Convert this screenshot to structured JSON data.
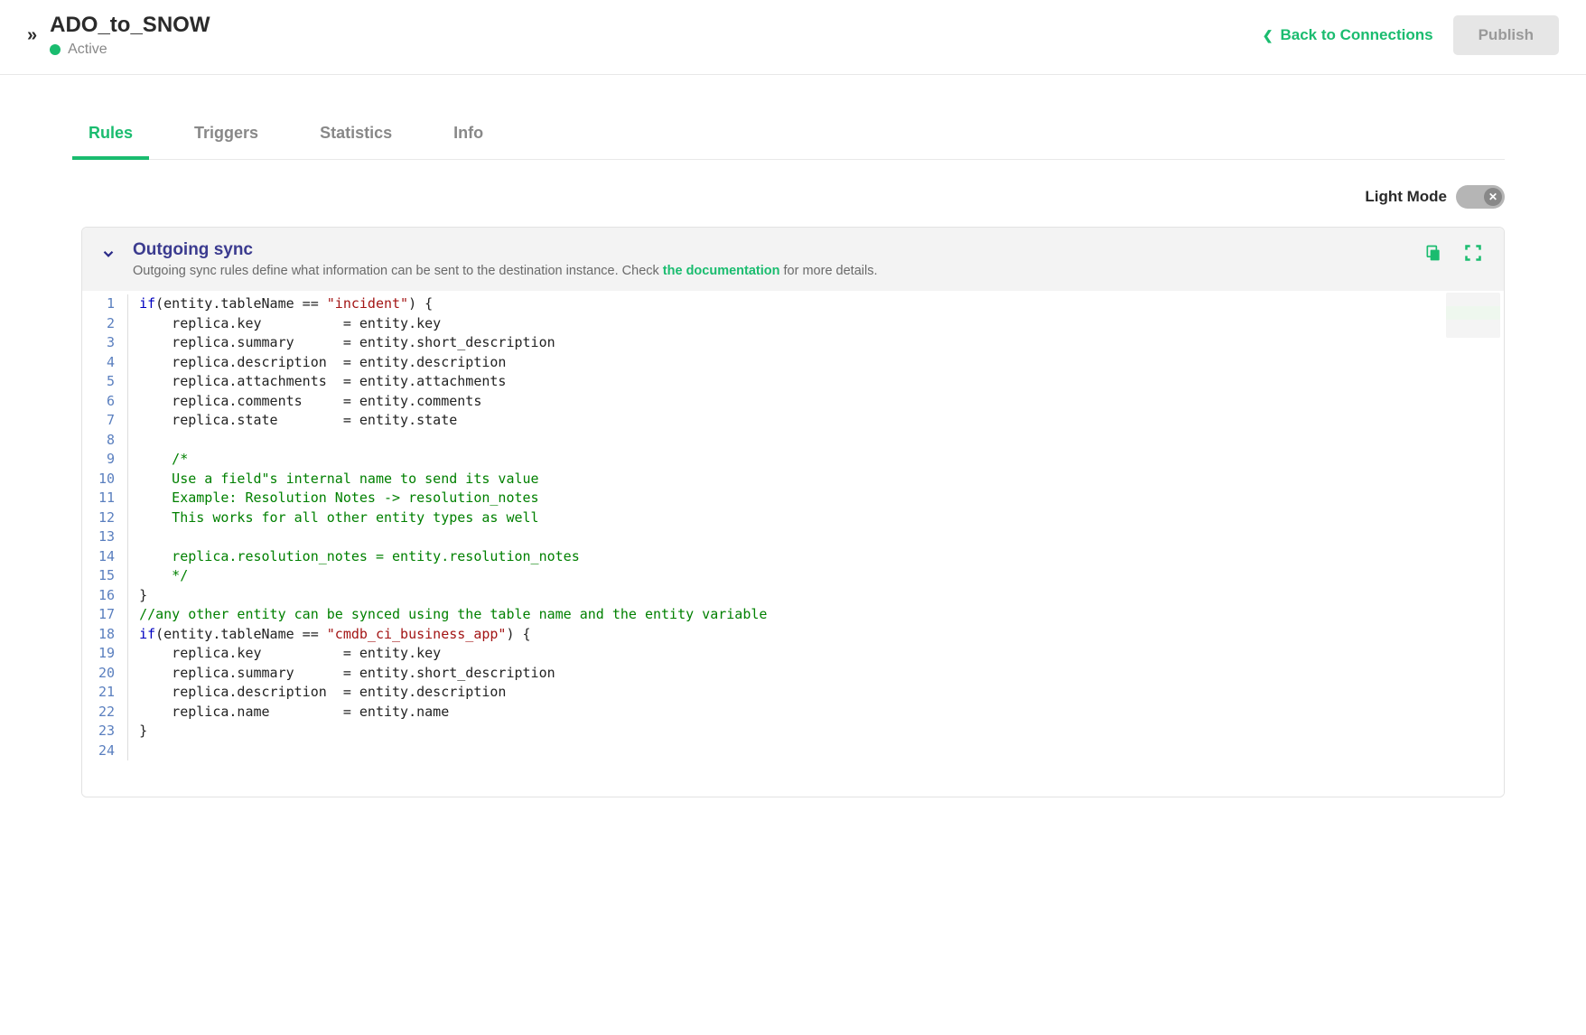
{
  "header": {
    "title": "ADO_to_SNOW",
    "status": "Active",
    "back_label": "Back to Connections",
    "publish_label": "Publish"
  },
  "tabs": [
    {
      "label": "Rules",
      "active": true
    },
    {
      "label": "Triggers",
      "active": false
    },
    {
      "label": "Statistics",
      "active": false
    },
    {
      "label": "Info",
      "active": false
    }
  ],
  "mode": {
    "label": "Light Mode",
    "enabled": false
  },
  "panel": {
    "title": "Outgoing sync",
    "desc_pre": "Outgoing sync rules define what information can be sent to the destination instance. Check ",
    "doc_link": "the documentation",
    "desc_post": " for more details."
  },
  "code": {
    "lines": [
      {
        "n": 1,
        "t": [
          [
            "kw",
            "if"
          ],
          [
            "punc",
            "("
          ],
          [
            "id",
            "entity.tableName == "
          ],
          [
            "str",
            "\"incident\""
          ],
          [
            "punc",
            ") {"
          ]
        ]
      },
      {
        "n": 2,
        "t": [
          [
            "id",
            "    replica.key          = entity.key"
          ]
        ]
      },
      {
        "n": 3,
        "t": [
          [
            "id",
            "    replica.summary      = entity.short_description"
          ]
        ]
      },
      {
        "n": 4,
        "t": [
          [
            "id",
            "    replica.description  = entity.description"
          ]
        ]
      },
      {
        "n": 5,
        "t": [
          [
            "id",
            "    replica.attachments  = entity.attachments"
          ]
        ]
      },
      {
        "n": 6,
        "t": [
          [
            "id",
            "    replica.comments     = entity.comments"
          ]
        ]
      },
      {
        "n": 7,
        "t": [
          [
            "id",
            "    replica.state        = entity.state"
          ]
        ]
      },
      {
        "n": 8,
        "t": [
          [
            "id",
            ""
          ]
        ]
      },
      {
        "n": 9,
        "t": [
          [
            "com",
            "    /*"
          ]
        ]
      },
      {
        "n": 10,
        "t": [
          [
            "com",
            "    Use a field\"s internal name to send its value"
          ]
        ]
      },
      {
        "n": 11,
        "t": [
          [
            "com",
            "    Example: Resolution Notes -> resolution_notes"
          ]
        ]
      },
      {
        "n": 12,
        "t": [
          [
            "com",
            "    This works for all other entity types as well"
          ]
        ]
      },
      {
        "n": 13,
        "t": [
          [
            "com",
            ""
          ]
        ]
      },
      {
        "n": 14,
        "t": [
          [
            "com",
            "    replica.resolution_notes = entity.resolution_notes"
          ]
        ]
      },
      {
        "n": 15,
        "t": [
          [
            "com",
            "    */"
          ]
        ]
      },
      {
        "n": 16,
        "t": [
          [
            "punc",
            "}"
          ]
        ]
      },
      {
        "n": 17,
        "t": [
          [
            "com",
            "//any other entity can be synced using the table name and the entity variable"
          ]
        ]
      },
      {
        "n": 18,
        "t": [
          [
            "kw",
            "if"
          ],
          [
            "punc",
            "("
          ],
          [
            "id",
            "entity.tableName == "
          ],
          [
            "str",
            "\"cmdb_ci_business_app\""
          ],
          [
            "punc",
            ") {"
          ]
        ]
      },
      {
        "n": 19,
        "t": [
          [
            "id",
            "    replica.key          = entity.key"
          ]
        ]
      },
      {
        "n": 20,
        "t": [
          [
            "id",
            "    replica.summary      = entity.short_description"
          ]
        ]
      },
      {
        "n": 21,
        "t": [
          [
            "id",
            "    replica.description  = entity.description"
          ]
        ]
      },
      {
        "n": 22,
        "t": [
          [
            "id",
            "    replica.name         = entity.name"
          ]
        ]
      },
      {
        "n": 23,
        "t": [
          [
            "punc",
            "}"
          ]
        ]
      },
      {
        "n": 24,
        "t": [
          [
            "id",
            ""
          ]
        ]
      }
    ]
  }
}
